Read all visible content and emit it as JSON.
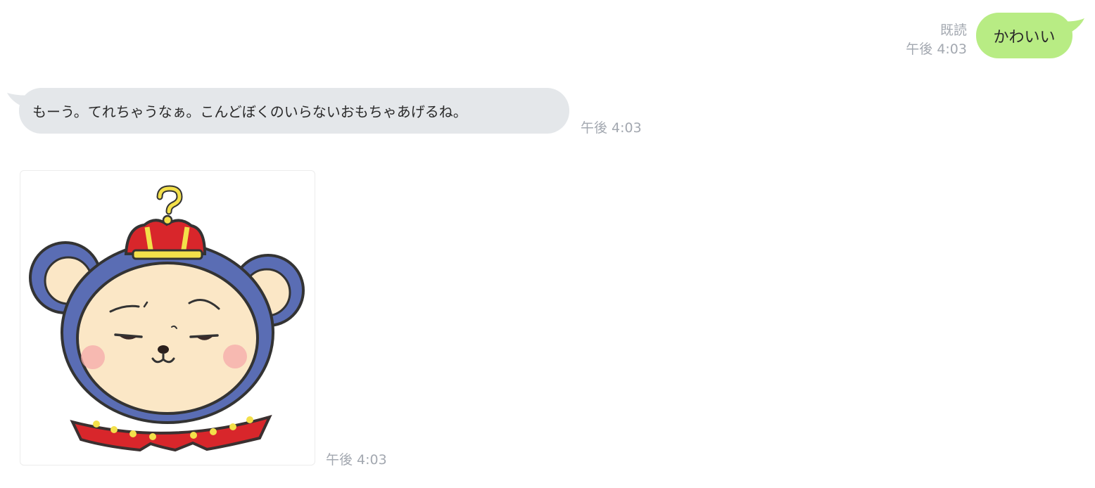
{
  "outgoing": {
    "text": "かわいい",
    "read_status": "既読",
    "time": "午後 4:03",
    "bubble_color": "#b8ec84"
  },
  "incoming": {
    "text": "もーう。てれちゃうなぁ。こんどぼくのいらないおもちゃあげるね。",
    "time": "午後 4:03",
    "bubble_color": "#e4e7ea"
  },
  "sticker": {
    "icon": "crowned-mouse-sticker",
    "time": "午後 4:03"
  }
}
